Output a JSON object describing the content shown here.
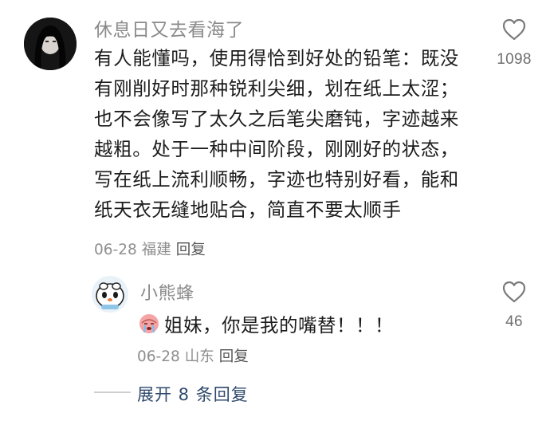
{
  "comment": {
    "username": "休息日又去看海了",
    "text": "有人能懂吗，使用得恰到好处的铅笔：既没有刚削好时那种锐利尖细，划在纸上太涩；也不会像写了太久之后笔尖磨钝，字迹越来越粗。处于一种中间阶段，刚刚好的状态，写在纸上流利顺畅，字迹也特别好看，能和纸天衣无缝地贴合，简直不要太顺手",
    "date": "06-28",
    "location": "福建",
    "reply_label": "回复",
    "likes": "1098",
    "like_icon": "heart-outline-icon"
  },
  "reply": {
    "username": "小熊蜂",
    "emoji_icon": "crying-face-emoji",
    "text": "姐妹，你是我的嘴替！！！",
    "date": "06-28",
    "location": "山东",
    "reply_label": "回复",
    "likes": "46",
    "like_icon": "heart-outline-icon"
  },
  "expand": {
    "label": "展开 8 条回复"
  },
  "colors": {
    "username": "#8a8a8a",
    "text": "#1c1c1c",
    "meta": "#8e8e8e",
    "expand_link": "#2f4a6e",
    "heart_stroke": "#7a7a7a"
  }
}
